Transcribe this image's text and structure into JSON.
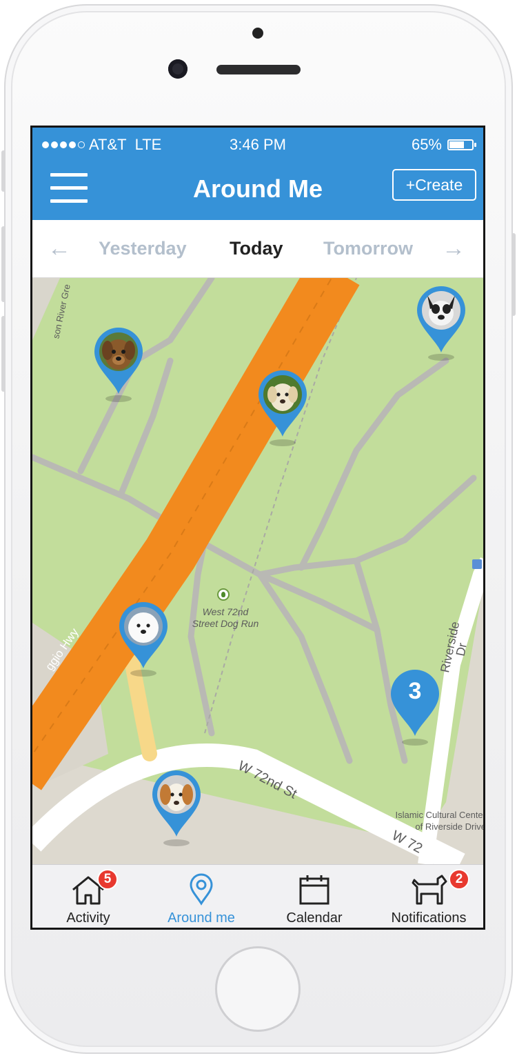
{
  "status_bar": {
    "carrier": "AT&T",
    "network": "LTE",
    "time": "3:46 PM",
    "battery_text": "65%",
    "battery_level": 0.65,
    "signal_bars": 4
  },
  "nav": {
    "title": "Around Me",
    "create_label": "+Create",
    "menu_icon": "hamburger-icon"
  },
  "day_selector": {
    "prev_arrow": "←",
    "next_arrow": "→",
    "days": [
      "Yesterday",
      "Today",
      "Tomorrow"
    ],
    "selected": "Today"
  },
  "map": {
    "poi_label_line1": "West 72nd",
    "poi_label_line2": "Street Dog Run",
    "street_w72": "W 72nd St",
    "street_w72_cut": "W 72",
    "street_riverside": "Riverside Dr",
    "street_river_blvd": "son River Gre",
    "street_hwy": "ggio Hwy",
    "islamic_line1": "Islamic Cultural Center",
    "islamic_line2": "of Riverside Drive",
    "cluster_count": "3",
    "pin_color": "#3692d8",
    "highway_color": "#f28a1e",
    "park_color": "#c2dd9b"
  },
  "tab_bar": {
    "tabs": [
      {
        "label": "Activity",
        "icon": "house-icon",
        "badge": "5"
      },
      {
        "label": "Around me",
        "icon": "location-pin-icon",
        "badge": ""
      },
      {
        "label": "Calendar",
        "icon": "calendar-icon",
        "badge": ""
      },
      {
        "label": "Notifications",
        "icon": "dog-icon",
        "badge": "2"
      }
    ],
    "active_tab": "Around me",
    "active_color": "#3692d8"
  }
}
